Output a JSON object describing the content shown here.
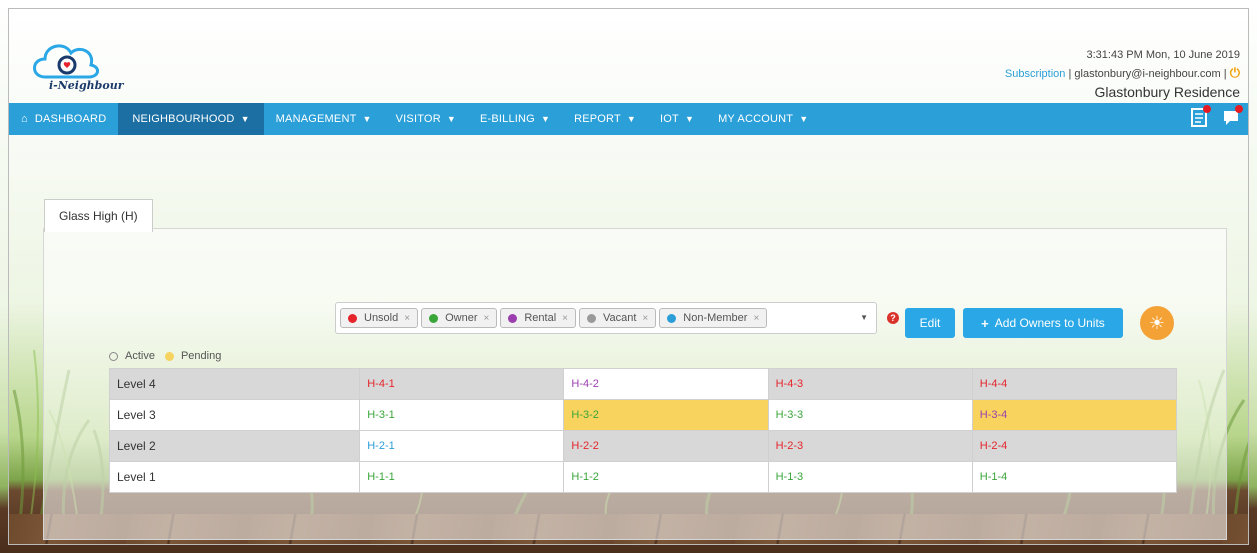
{
  "header": {
    "logo_text": "i-Neighbour",
    "datetime": "3:31:43 PM  Mon, 10 June 2019",
    "subscription_label": "Subscription",
    "separator": "|",
    "user_email": "glastonbury@i-neighbour.com",
    "separator2": "|",
    "residence": "Glastonbury Residence"
  },
  "nav": {
    "items": [
      {
        "label": "DASHBOARD",
        "icon": "home-icon",
        "has_caret": false,
        "active": false
      },
      {
        "label": "NEIGHBOURHOOD",
        "has_caret": true,
        "active": true
      },
      {
        "label": "MANAGEMENT",
        "has_caret": true,
        "active": false
      },
      {
        "label": "VISITOR",
        "has_caret": true,
        "active": false
      },
      {
        "label": "E-BILLING",
        "has_caret": true,
        "active": false
      },
      {
        "label": "REPORT",
        "has_caret": true,
        "active": false
      },
      {
        "label": "IOT",
        "has_caret": true,
        "active": false
      },
      {
        "label": "MY ACCOUNT",
        "has_caret": true,
        "active": false
      }
    ],
    "right_icons": [
      "notes-icon",
      "chat-icon"
    ]
  },
  "tab": {
    "label": "Glass High (H)"
  },
  "filter": {
    "chips": [
      {
        "label": "Unsold",
        "color": "#e5242b"
      },
      {
        "label": "Owner",
        "color": "#3aa63a"
      },
      {
        "label": "Rental",
        "color": "#9b3fae"
      },
      {
        "label": "Vacant",
        "color": "#9a9a9a"
      },
      {
        "label": "Non-Member",
        "color": "#2b9ed8"
      }
    ],
    "remove_glyph": "×"
  },
  "buttons": {
    "edit": "Edit",
    "add_owners": "Add Owners to Units"
  },
  "legend": {
    "active": "Active",
    "pending": "Pending"
  },
  "grid": {
    "rows": [
      {
        "level": "Level 4",
        "bg": "grey",
        "units": [
          {
            "code": "H-4-1",
            "color": "red",
            "bg": "grey"
          },
          {
            "code": "H-4-2",
            "color": "purple",
            "bg": "white"
          },
          {
            "code": "H-4-3",
            "color": "red",
            "bg": "grey"
          },
          {
            "code": "H-4-4",
            "color": "red",
            "bg": "grey"
          }
        ]
      },
      {
        "level": "Level 3",
        "bg": "white",
        "units": [
          {
            "code": "H-3-1",
            "color": "green",
            "bg": "white"
          },
          {
            "code": "H-3-2",
            "color": "green",
            "bg": "yellow"
          },
          {
            "code": "H-3-3",
            "color": "green",
            "bg": "white"
          },
          {
            "code": "H-3-4",
            "color": "purple",
            "bg": "yellow"
          }
        ]
      },
      {
        "level": "Level 2",
        "bg": "grey",
        "units": [
          {
            "code": "H-2-1",
            "color": "blue",
            "bg": "white"
          },
          {
            "code": "H-2-2",
            "color": "red",
            "bg": "grey"
          },
          {
            "code": "H-2-3",
            "color": "red",
            "bg": "grey"
          },
          {
            "code": "H-2-4",
            "color": "red",
            "bg": "grey"
          }
        ]
      },
      {
        "level": "Level 1",
        "bg": "white",
        "units": [
          {
            "code": "H-1-1",
            "color": "green",
            "bg": "white"
          },
          {
            "code": "H-1-2",
            "color": "green",
            "bg": "white"
          },
          {
            "code": "H-1-3",
            "color": "green",
            "bg": "white"
          },
          {
            "code": "H-1-4",
            "color": "green",
            "bg": "white"
          }
        ]
      }
    ]
  },
  "colors": {
    "nav_bg": "#2a9fd8",
    "nav_active": "#1b6fa3",
    "button": "#2aa7e6",
    "pending": "#f8d45e",
    "unsold": "#e5242b",
    "owner": "#3aa63a",
    "rental": "#9b3fae",
    "non_member": "#2b9ed8"
  }
}
